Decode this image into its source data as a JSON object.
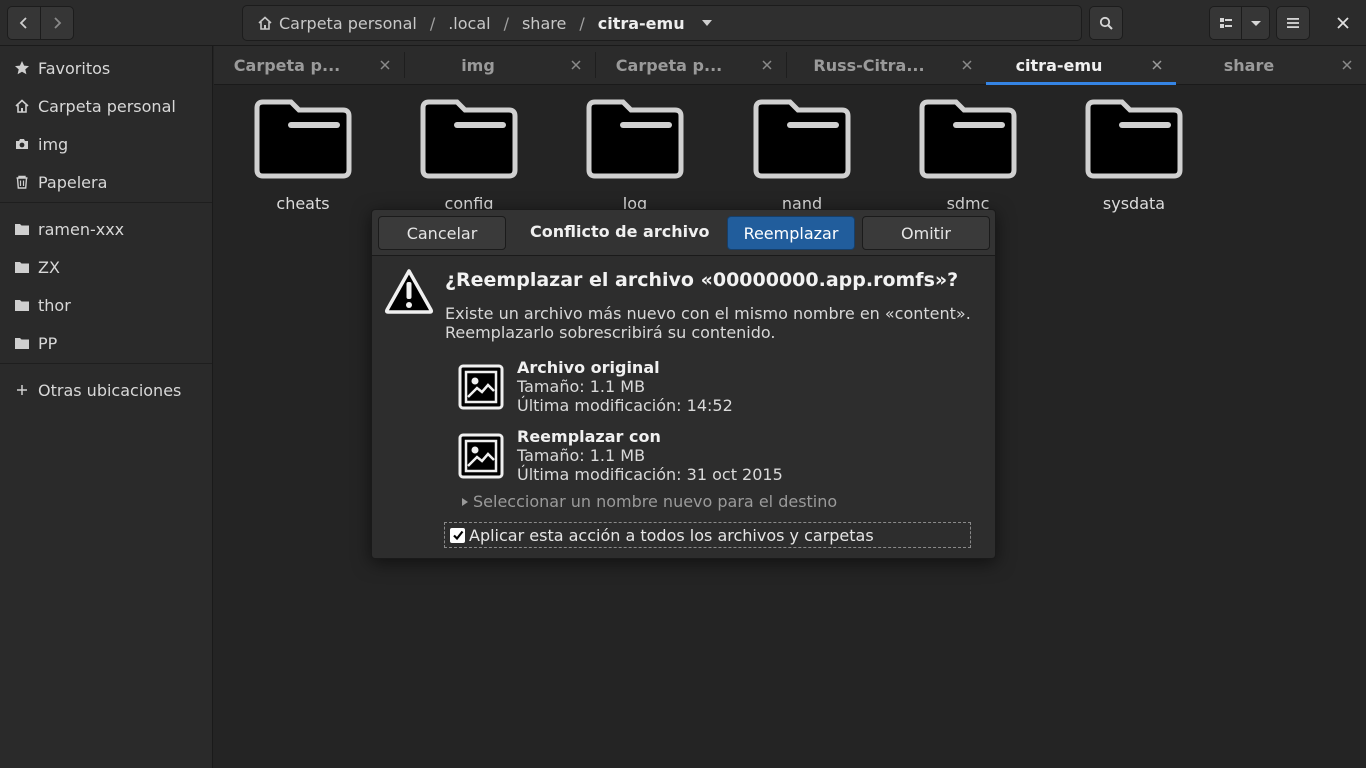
{
  "header": {
    "path": [
      "Carpeta personal",
      ".local",
      "share",
      "citra-emu"
    ],
    "separator": "/"
  },
  "sidebar": {
    "items": [
      {
        "label": "Favoritos",
        "icon": "star-icon"
      },
      {
        "label": "Carpeta personal",
        "icon": "home-icon"
      },
      {
        "label": "img",
        "icon": "camera-icon"
      },
      {
        "label": "Papelera",
        "icon": "trash-icon"
      },
      {
        "label": "ramen-xxx",
        "icon": "folder-icon"
      },
      {
        "label": "ZX",
        "icon": "folder-icon"
      },
      {
        "label": "thor",
        "icon": "folder-icon"
      },
      {
        "label": "PP",
        "icon": "folder-icon"
      },
      {
        "label": "Otras ubicaciones",
        "icon": "plus-icon"
      }
    ]
  },
  "tabs": [
    {
      "label": "Carpeta p...",
      "active": false
    },
    {
      "label": "img",
      "active": false
    },
    {
      "label": "Carpeta p...",
      "active": false
    },
    {
      "label": "Russ-Citra...",
      "active": false
    },
    {
      "label": "citra-emu",
      "active": true
    },
    {
      "label": "share",
      "active": false
    }
  ],
  "files": [
    "cheats",
    "config",
    "log",
    "nand",
    "sdmc",
    "sysdata"
  ],
  "dialog": {
    "cancel_label": "Cancelar",
    "title": "Conflicto de archivo",
    "replace_label": "Reemplazar",
    "skip_label": "Omitir",
    "heading": "¿Reemplazar el archivo «00000000.app.romfs»?",
    "description_line1": "Existe un archivo más nuevo con el mismo nombre en «content».",
    "description_line2": "Reemplazarlo sobrescribirá su contenido.",
    "original": {
      "title": "Archivo original",
      "size": "Tamaño: 1.1 MB",
      "modified": "Última modificación: 14:52"
    },
    "replacement": {
      "title": "Reemplazar con",
      "size": "Tamaño: 1.1 MB",
      "modified": "Última modificación: 31 oct 2015"
    },
    "rename_label": "Seleccionar un nombre nuevo para el destino",
    "apply_all_label": "Aplicar esta acción a todos los archivos y carpetas",
    "apply_all_checked": true
  },
  "colors": {
    "accent": "#3584e4",
    "suggested_button": "#215d9c"
  }
}
